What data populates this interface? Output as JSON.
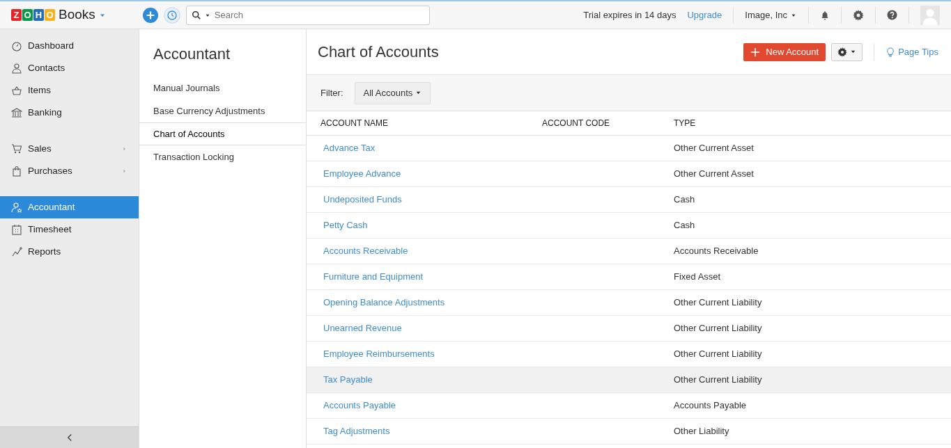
{
  "topbar": {
    "logo_letters": [
      {
        "letter": "Z",
        "color": "#e42527"
      },
      {
        "letter": "O",
        "color": "#089949"
      },
      {
        "letter": "H",
        "color": "#226db4"
      },
      {
        "letter": "O",
        "color": "#f9b21d"
      }
    ],
    "app_name": "Books",
    "search": {
      "placeholder": "Search"
    },
    "trial_text": "Trial expires in 14 days",
    "upgrade": "Upgrade",
    "org": "Image, Inc"
  },
  "sidebar": {
    "groups": [
      {
        "items": [
          {
            "label": "Dashboard",
            "selected": false,
            "has_submenu": false
          },
          {
            "label": "Contacts",
            "selected": false,
            "has_submenu": false
          },
          {
            "label": "Items",
            "selected": false,
            "has_submenu": false
          },
          {
            "label": "Banking",
            "selected": false,
            "has_submenu": false
          }
        ]
      },
      {
        "items": [
          {
            "label": "Sales",
            "selected": false,
            "has_submenu": true
          },
          {
            "label": "Purchases",
            "selected": false,
            "has_submenu": true
          }
        ]
      },
      {
        "items": [
          {
            "label": "Accountant",
            "selected": true,
            "has_submenu": false
          },
          {
            "label": "Timesheet",
            "selected": false,
            "has_submenu": false
          },
          {
            "label": "Reports",
            "selected": false,
            "has_submenu": false
          }
        ]
      }
    ]
  },
  "subpanel": {
    "title": "Accountant",
    "items": [
      {
        "label": "Manual Journals",
        "selected": false
      },
      {
        "label": "Base Currency Adjustments",
        "selected": false
      },
      {
        "label": "Chart of Accounts",
        "selected": true
      },
      {
        "label": "Transaction Locking",
        "selected": false
      }
    ]
  },
  "main": {
    "title": "Chart of Accounts",
    "new_button": "New Account",
    "page_tips": "Page Tips",
    "filter_label": "Filter:",
    "filter_value": "All Accounts",
    "table": {
      "columns": [
        "ACCOUNT NAME",
        "ACCOUNT CODE",
        "TYPE"
      ],
      "rows": [
        {
          "name": "Advance Tax",
          "type": "Other Current Asset",
          "highlighted": false
        },
        {
          "name": "Employee Advance",
          "type": "Other Current Asset",
          "highlighted": false
        },
        {
          "name": "Undeposited Funds",
          "type": "Cash",
          "highlighted": false
        },
        {
          "name": "Petty Cash",
          "type": "Cash",
          "highlighted": false
        },
        {
          "name": "Accounts Receivable",
          "type": "Accounts Receivable",
          "highlighted": false
        },
        {
          "name": "Furniture and Equipment",
          "type": "Fixed Asset",
          "highlighted": false
        },
        {
          "name": "Opening Balance Adjustments",
          "type": "Other Current Liability",
          "highlighted": false
        },
        {
          "name": "Unearned Revenue",
          "type": "Other Current Liability",
          "highlighted": false
        },
        {
          "name": "Employee Reimbursements",
          "type": "Other Current Liability",
          "highlighted": false
        },
        {
          "name": "Tax Payable",
          "type": "Other Current Liability",
          "highlighted": true
        },
        {
          "name": "Accounts Payable",
          "type": "Accounts Payable",
          "highlighted": false
        },
        {
          "name": "Tag Adjustments",
          "type": "Other Liability",
          "highlighted": false
        }
      ]
    }
  }
}
